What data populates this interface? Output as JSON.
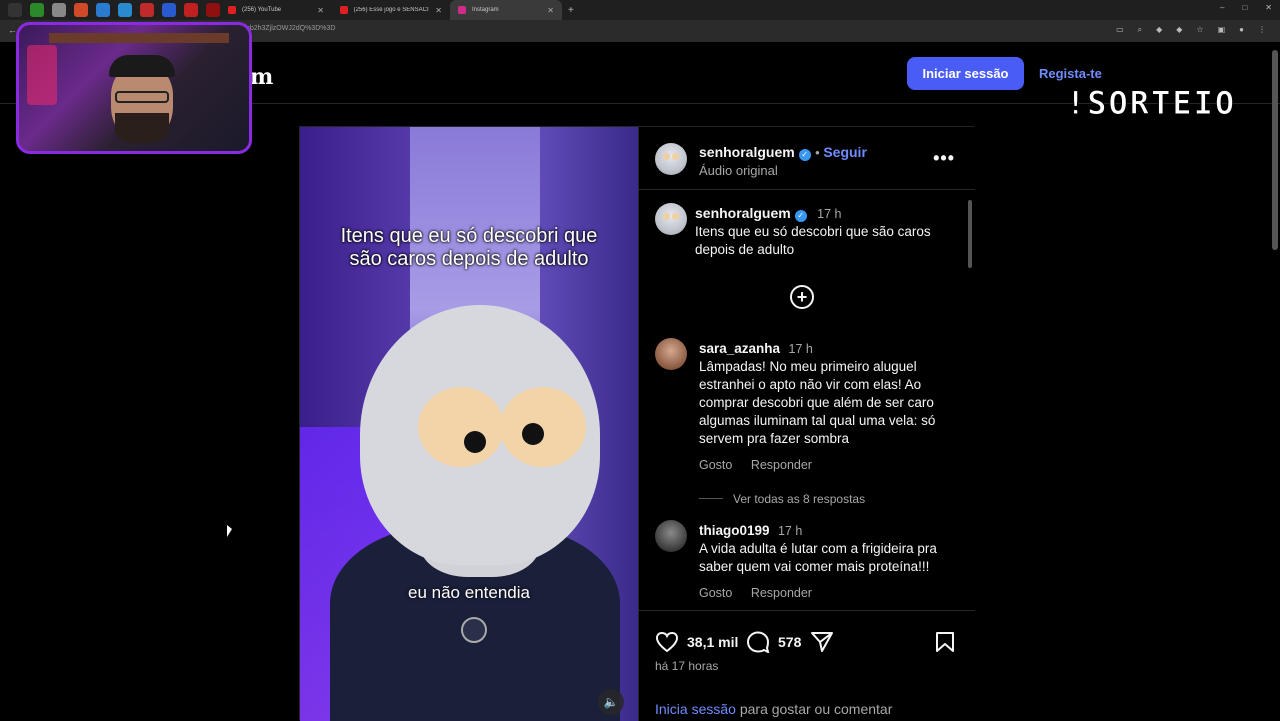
{
  "browser": {
    "tabs": [
      {
        "label": "(256) YouTube"
      },
      {
        "label": "(256) Esse jogo é SENSACIONA..."
      },
      {
        "label": "Instagram"
      }
    ],
    "url_fragment": "mb2h3ZjlzOWJ2dQ%3D%3D"
  },
  "topnav": {
    "logo_fragment": "m",
    "login_label": "Iniciar sessão",
    "signup_label": "Regista-te"
  },
  "overlay": {
    "sorteio_text": "!SORTEIO"
  },
  "video": {
    "caption_top": "Itens que eu só descobri que são caros depois de adulto",
    "caption_bottom": "eu não entendia"
  },
  "post_header": {
    "username": "senhoralguem",
    "follow_label": "Seguir",
    "audio_label": "Áudio original"
  },
  "comments": [
    {
      "username": "senhoralguem",
      "time": "17 h",
      "text": "Itens que eu só descobri que são caros depois de adulto",
      "is_caption": true
    },
    {
      "username": "sara_azanha",
      "time": "17 h",
      "text": "Lâmpadas! No meu primeiro aluguel estranhei o apto não vir com elas! Ao comprar descobri que além de ser caro algumas iluminam tal qual uma vela: só servem pra fazer sombra",
      "like_label": "Gosto",
      "reply_label": "Responder",
      "view_replies": "Ver todas as 8 respostas"
    },
    {
      "username": "thiago0199",
      "time": "17 h",
      "text": "A vida adulta é lutar com a frigideira pra saber quem vai comer mais proteína!!!",
      "like_label": "Gosto",
      "reply_label": "Responder"
    }
  ],
  "actions": {
    "likes": "38,1 mil",
    "comments": "578",
    "posted_ago": "há 17 horas",
    "login_link": "Inicia sessão",
    "login_suffix": "para gostar ou comentar"
  },
  "colors": {
    "accent": "#4a5cf6",
    "link": "#6f8cff",
    "verified": "#3897f0",
    "background": "#000000"
  }
}
